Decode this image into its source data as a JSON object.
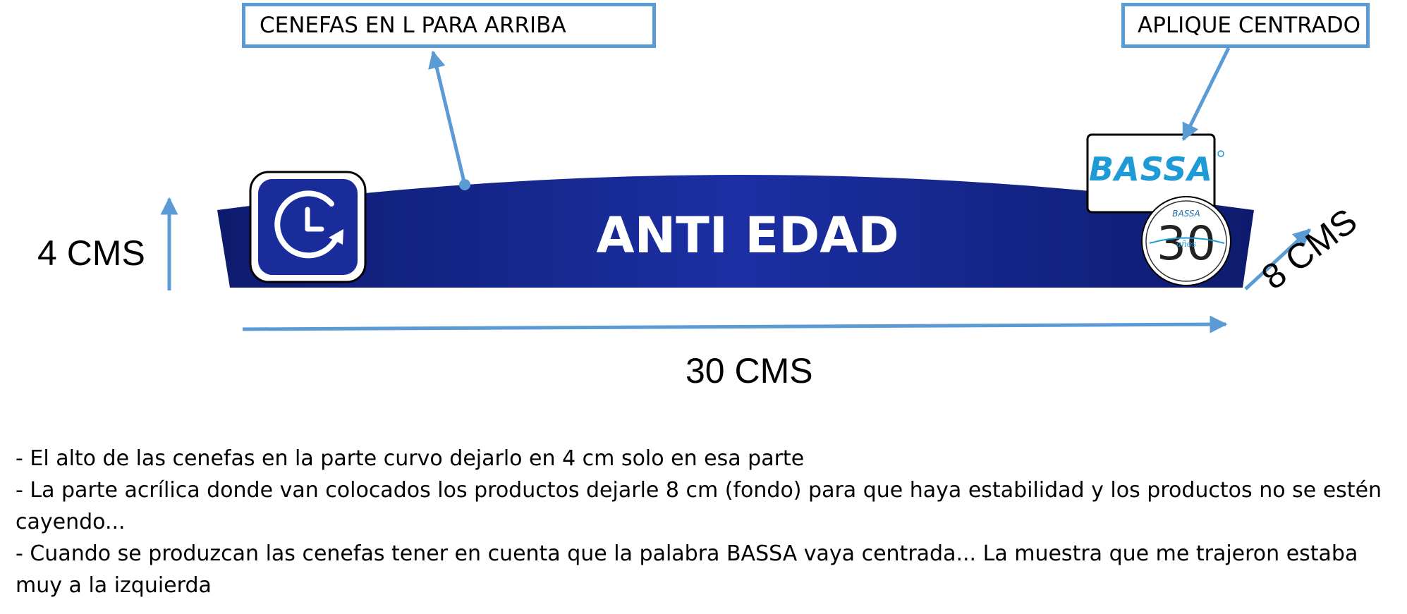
{
  "callouts": {
    "cenefas": "CENEFAS EN L PARA ARRIBA",
    "aplique": "APLIQUE CENTRADO"
  },
  "dimensions": {
    "height": "4 CMS",
    "width": "30 CMS",
    "depth": "8 CMS"
  },
  "banner": {
    "title": "ANTI EDAD",
    "brand_logo_text": "BASSA",
    "anniversary_small_text": "BASSA",
    "anniversary_number": "30",
    "anniversary_script": "años",
    "icon": "clock-refresh-icon"
  },
  "notes": [
    "- El alto de las cenefas en la parte curvo dejarlo en 4 cm solo en esa parte",
    "- La parte acrílica donde van colocados los productos dejarle 8 cm (fondo) para que haya estabilidad y los productos no se estén cayendo...",
    "- Cuando se produzcan las cenefas tener en cuenta que la palabra BASSA vaya centrada... La muestra que me trajeron estaba muy a la izquierda"
  ],
  "colors": {
    "banner_dark": "#0d1b6e",
    "banner_mid": "#1a2c9a",
    "arrow_blue": "#5b9bd5",
    "brand_cyan": "#1e9ad6"
  }
}
